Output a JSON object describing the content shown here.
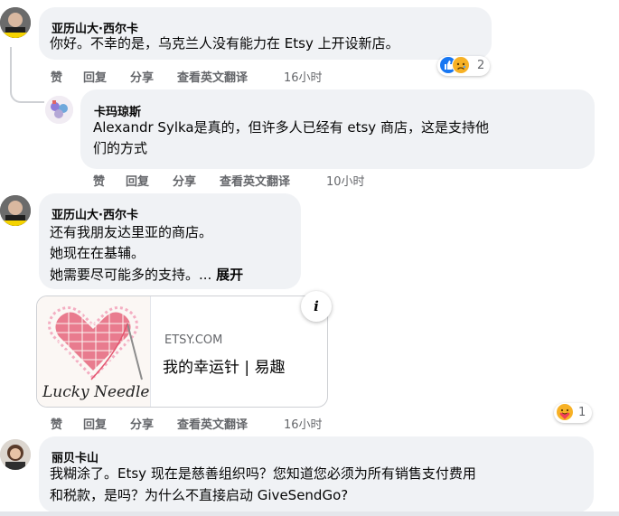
{
  "actions": {
    "like": "赞",
    "reply": "回复",
    "share": "分享",
    "translate": "查看英文翻译"
  },
  "comments": [
    {
      "author": "亚历山大·西尔卡",
      "lines": [
        "你好。不幸的是，乌克兰人没有能力在 Etsy 上开设新店。"
      ],
      "time": "16小时",
      "reaction_count": "2",
      "reaction_icons": [
        "like-icon",
        "sad-icon"
      ]
    },
    {
      "author": "卡玛琼斯",
      "lines": [
        "Alexandr Sylka是真的，但许多人已经有 etsy 商店，这是支持他",
        "们的方式"
      ],
      "time": "10小时"
    },
    {
      "author": "亚历山大·西尔卡",
      "lines": [
        "还有我朋友达里亚的商店。",
        "她现在在基辅。",
        "她需要尽可能多的支持。..."
      ],
      "see_more": "展开",
      "time": "16小时",
      "reaction_count": "1",
      "reaction_icons": [
        "care-icon"
      ],
      "link_preview": {
        "domain": "ETSY.COM",
        "title": "我的幸运针 | 易趣",
        "image_text": "Lucky Needle",
        "info": "i"
      }
    },
    {
      "author": "丽贝卡山",
      "lines": [
        "我糊涂了。Etsy 现在是慈善组织吗？您知道您必须为所有销售支付费用",
        "和税款，是吗？为什么不直接启动 GiveSendGo?"
      ]
    }
  ],
  "colors": {
    "bubble": "#f0f2f5",
    "meta": "#65676b",
    "like": "#1877f2",
    "sad": "#f7b125",
    "heart": "#e0245e"
  }
}
